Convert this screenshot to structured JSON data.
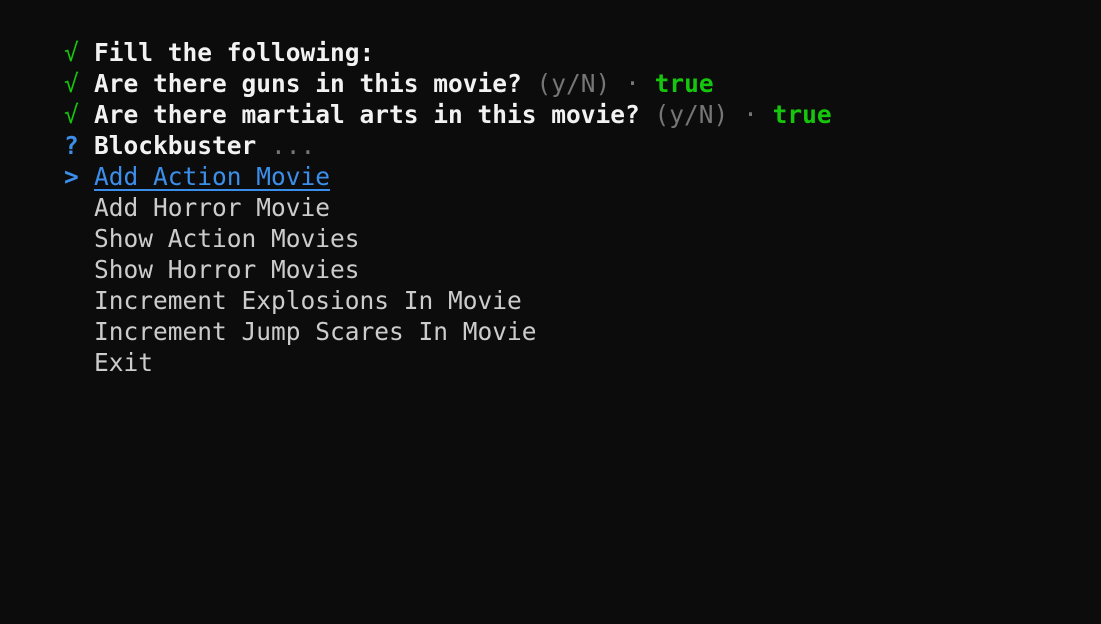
{
  "colors": {
    "background": "#0c0c0c",
    "check": "#16c60c",
    "prompt_accent": "#3b8eea",
    "hint": "#767676",
    "text": "#cccccc"
  },
  "answered": [
    {
      "mark": "√",
      "question": "Fill the following:",
      "hint": "",
      "separator": "",
      "answer": ""
    },
    {
      "mark": "√",
      "question": "Are there guns in this movie?",
      "hint": "(y/N)",
      "separator": "·",
      "answer": "true"
    },
    {
      "mark": "√",
      "question": "Are there martial arts in this movie?",
      "hint": "(y/N)",
      "separator": "·",
      "answer": "true"
    }
  ],
  "current": {
    "mark": "?",
    "question": "Blockbuster",
    "hint": "..."
  },
  "menu": {
    "pointer": ">",
    "items": [
      "Add Action Movie",
      "Add Horror Movie",
      "Show Action Movies",
      "Show Horror Movies",
      "Increment Explosions In Movie",
      "Increment Jump Scares In Movie",
      "Exit"
    ],
    "selected_index": 0
  }
}
